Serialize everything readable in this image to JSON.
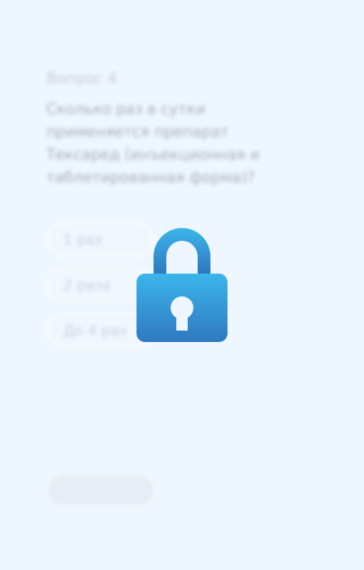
{
  "question": {
    "number_label": "Вопрос 4",
    "text": "Сколько раз в сутки применяется препарат Тексаред (инъекционная и таблетированная форма)?"
  },
  "options": [
    {
      "label": "1 раз"
    },
    {
      "label": "2 раза"
    },
    {
      "label": "До 4 раз"
    }
  ],
  "submit": {
    "label": ""
  },
  "overlay": {
    "icon": "lock-icon",
    "gradient_top": "#3bb6ea",
    "gradient_bottom": "#2f78bf"
  },
  "colors": {
    "background": "#eef6ff"
  }
}
